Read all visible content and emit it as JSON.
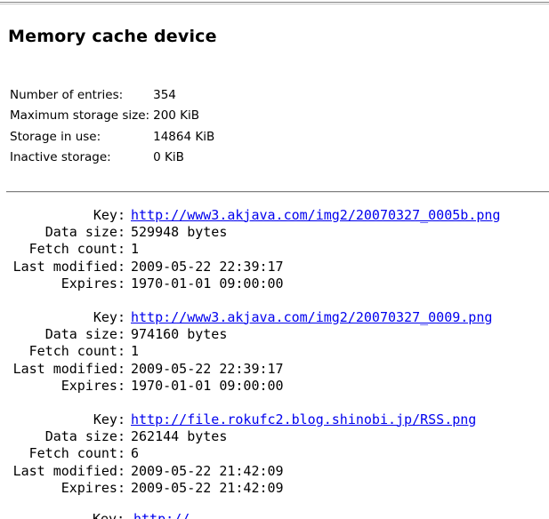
{
  "page": {
    "title": "Memory cache device"
  },
  "summary": {
    "rows": [
      {
        "label": "Number of entries:",
        "value": "354"
      },
      {
        "label": "Maximum storage size:",
        "value": "200 KiB"
      },
      {
        "label": "Storage in use:",
        "value": "14864 KiB"
      },
      {
        "label": "Inactive storage:",
        "value": "0 KiB"
      }
    ]
  },
  "labels": {
    "key": "Key:",
    "data_size": "Data size:",
    "fetch_count": "Fetch count:",
    "last_modified": "Last modified:",
    "expires": "Expires:"
  },
  "entries": [
    {
      "key": "http://www3.akjava.com/img2/20070327_0005b.png",
      "data_size": "529948 bytes",
      "fetch_count": "1",
      "last_modified": "2009-05-22 22:39:17",
      "expires": "1970-01-01 09:00:00"
    },
    {
      "key": "http://www3.akjava.com/img2/20070327_0009.png",
      "data_size": "974160 bytes",
      "fetch_count": "1",
      "last_modified": "2009-05-22 22:39:17",
      "expires": "1970-01-01 09:00:00"
    },
    {
      "key": "http://file.rokufc2.blog.shinobi.jp/RSS.png",
      "data_size": "262144 bytes",
      "fetch_count": "6",
      "last_modified": "2009-05-22 21:42:09",
      "expires": "2009-05-22 21:42:09"
    }
  ],
  "truncated_entry": {
    "key_label": "Key:",
    "key": "http://"
  }
}
